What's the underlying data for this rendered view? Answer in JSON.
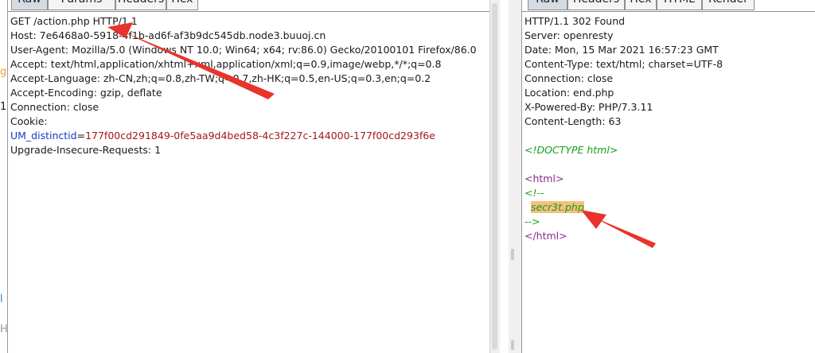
{
  "request_panel": {
    "tabs": [
      {
        "label": "Raw",
        "active": true
      },
      {
        "label": "Params",
        "active": false
      },
      {
        "label": "Headers",
        "active": false
      },
      {
        "label": "Hex",
        "active": false
      }
    ],
    "lines": {
      "request_line": "GET /action.php HTTP/1.1",
      "host": "Host: 7e6468a0-5918-4f1b-ad6f-af3b9dc545db.node3.buuoj.cn",
      "user_agent": "User-Agent: Mozilla/5.0 (Windows NT 10.0; Win64; x64; rv:86.0) Gecko/20100101 Firefox/86.0",
      "accept": "Accept: text/html,application/xhtml+xml,application/xml;q=0.9,image/webp,*/*;q=0.8",
      "accept_language": "Accept-Language: zh-CN,zh;q=0.8,zh-TW;q=0.7,zh-HK;q=0.5,en-US;q=0.3,en;q=0.2",
      "accept_encoding": "Accept-Encoding: gzip, deflate",
      "connection": "Connection: close",
      "cookie": "Cookie:",
      "cookie_name": "UM_distinctid",
      "cookie_eq": "=",
      "cookie_value": "177f00cd291849-0fe5aa9d4bed58-4c3f227c-144000-177f00cd293f6e",
      "upgrade": "Upgrade-Insecure-Requests: 1"
    }
  },
  "response_panel": {
    "tabs": [
      {
        "label": "Raw",
        "active": true
      },
      {
        "label": "Headers",
        "active": false
      },
      {
        "label": "Hex",
        "active": false
      },
      {
        "label": "HTML",
        "active": false
      },
      {
        "label": "Render",
        "active": false
      }
    ],
    "lines": {
      "status": "HTTP/1.1 302 Found",
      "server": "Server: openresty",
      "date": "Date: Mon, 15 Mar 2021 16:57:23 GMT",
      "content_type": "Content-Type: text/html; charset=UTF-8",
      "connection": "Connection: close",
      "location": "Location: end.php",
      "powered_by": "X-Powered-By: PHP/7.3.11",
      "content_length": "Content-Length: 63",
      "doctype": "<!DOCTYPE html>",
      "html_open": "<html>",
      "comment_open": "<!--",
      "comment_text": "secr3t.php",
      "comment_close": "-->",
      "html_close": "</html>"
    }
  },
  "left_edge_glyphs": [
    "g",
    "1",
    "l",
    "H"
  ],
  "colors": {
    "header_name": "#1838c4",
    "header_value": "#a31818",
    "comment": "#17a017",
    "tag": "#8a2a8a",
    "highlight": "#f5c07e",
    "annotation_arrow": "#e8342a"
  }
}
